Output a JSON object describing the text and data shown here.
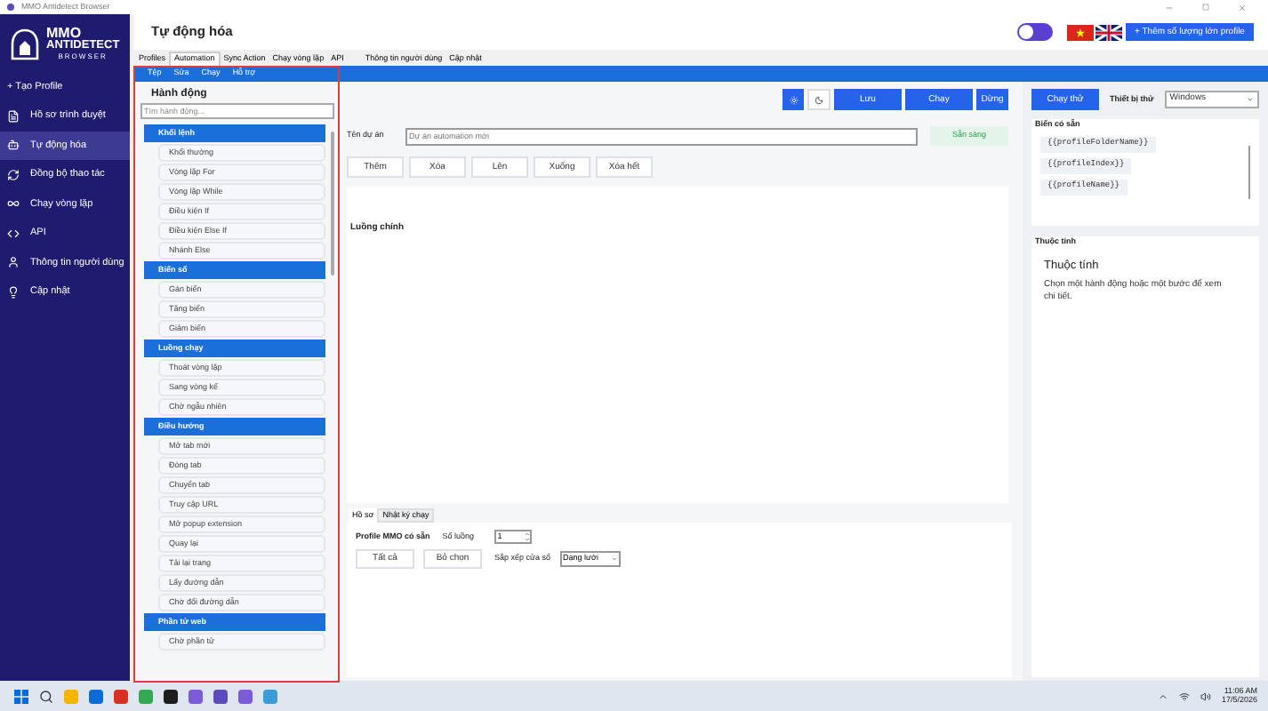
{
  "window": {
    "title": "MMO Antidetect Browser"
  },
  "sidebar": {
    "logo": [
      "MMO",
      "ANTIDETECT",
      "BROWSER"
    ],
    "create_profile": "+ Tạo Profile",
    "items": [
      {
        "label": "Hồ sơ trình duyệt",
        "selected": false
      },
      {
        "label": "Tự động hóa",
        "selected": true
      },
      {
        "label": "Đồng bộ thao tác",
        "selected": false
      },
      {
        "label": "Chạy vòng lặp",
        "selected": false
      },
      {
        "label": "API",
        "selected": false
      },
      {
        "label": "Thông tin người dùng",
        "selected": false
      },
      {
        "label": "Cập nhật",
        "selected": false
      }
    ]
  },
  "header": {
    "title": "Tự động hóa",
    "theme_switch": {
      "on": false
    },
    "bulk_button": "+ Thêm số lượng lớn profile"
  },
  "tabs": [
    {
      "label": "Profiles",
      "selected": false
    },
    {
      "label": "Automation",
      "selected": true
    },
    {
      "label": "Sync Action",
      "selected": false
    },
    {
      "label": "Chạy vòng lặp",
      "selected": false
    },
    {
      "label": "API",
      "selected": false
    },
    {
      "label": "Thông tin người dùng",
      "selected": false
    },
    {
      "label": "Cập nhật",
      "selected": false
    }
  ],
  "menu": [
    "Tệp",
    "Sửa",
    "Chạy",
    "Hỗ trợ"
  ],
  "actions": {
    "title": "Hành động",
    "search": {
      "placeholder": "Tìm hành động..."
    },
    "groups": [
      {
        "name": "Khối lệnh",
        "items": [
          "Khối thường",
          "Vòng lặp For",
          "Vòng lặp While",
          "Điều kiện If",
          "Điều kiện Else If",
          "Nhánh Else"
        ]
      },
      {
        "name": "Biến số",
        "items": [
          "Gán biến",
          "Tăng biến",
          "Giảm biến"
        ]
      },
      {
        "name": "Luồng chạy",
        "items": [
          "Thoát vòng lặp",
          "Sang vòng kế",
          "Chờ ngẫu nhiên"
        ]
      },
      {
        "name": "Điều hướng",
        "items": [
          "Mở tab mới",
          "Đóng tab",
          "Chuyển tab",
          "Truy cập URL",
          "Mở popup extension",
          "Quay lại",
          "Tải lại trang",
          "Lấy đường dẫn",
          "Chờ đổi đường dẫn"
        ]
      },
      {
        "name": "Phần tử web",
        "items": [
          "Chờ phần tử"
        ]
      }
    ]
  },
  "editor": {
    "buttons": [
      "Lưu",
      "Chạy",
      "Dừng"
    ],
    "project_label": "Tên dự án",
    "project_placeholder": "Dự án automation mới",
    "status": "Sẵn sàng",
    "step_buttons": [
      "Thêm",
      "Xóa",
      "Lên",
      "Xuống",
      "Xóa hết"
    ],
    "flow_title": "Luồng chính"
  },
  "bottom_tabs": [
    {
      "label": "Hồ sơ",
      "selected": true
    },
    {
      "label": "Nhật ký chạy",
      "selected": false
    }
  ],
  "profiles": {
    "label": "Profile MMO có sẵn",
    "threads_label": "Số luồng",
    "threads": "1",
    "buttons": [
      "Tất cả",
      "Bỏ chọn"
    ],
    "arrange_label": "Sắp xếp cửa sổ",
    "arrange": "Dạng lưới"
  },
  "test": {
    "button": "Chạy thử",
    "device_label": "Thiết bị thử",
    "device": "Windows",
    "variables_title": "Biến có sẵn",
    "variables": [
      "{{profileFolderName}}",
      "{{profileIndex}}",
      "{{profileName}}"
    ],
    "properties_label": "Thuộc tính",
    "properties_title": "Thuộc tính",
    "properties_text": "Chọn một hành động hoặc một bước để xem chi tiết."
  },
  "taskbar": {
    "time": "11:06 AM",
    "date": "17/5/2026"
  }
}
